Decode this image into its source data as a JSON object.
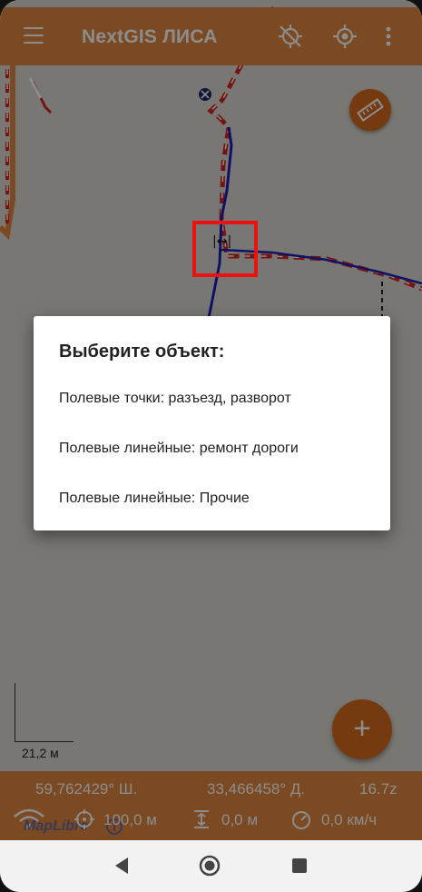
{
  "app": {
    "title": "NextGIS ЛИСА"
  },
  "icons": {
    "menu": "hamburger-icon",
    "gps_off": "gps-off-icon",
    "locate": "crosshair-icon",
    "more": "more-vert-icon",
    "ruler": "ruler-icon",
    "add": "plus-icon",
    "accuracy": "target-icon",
    "altitude": "altitude-icon",
    "speed": "speedometer-icon"
  },
  "colors": {
    "accent": "#e0883f",
    "fab": "#d66a1c",
    "track_blue": "#1a22b8",
    "road_red": "#d6261f",
    "highlight": "#ee1111"
  },
  "map": {
    "scale_label": "21,2 м",
    "attribution": "MapLibre",
    "add_label": "+"
  },
  "dialog": {
    "title": "Выберите объект:",
    "options": [
      "Полевые точки: разъезд, разворот",
      "Полевые линейные: ремонт дороги",
      "Полевые линейные: Прочие"
    ]
  },
  "status": {
    "latitude": "59,762429° Ш.",
    "longitude": "33,466458° Д.",
    "zoom": "16.7z",
    "accuracy": "100,0 м",
    "altitude": "0,0 м",
    "speed": "0,0 км/ч"
  }
}
